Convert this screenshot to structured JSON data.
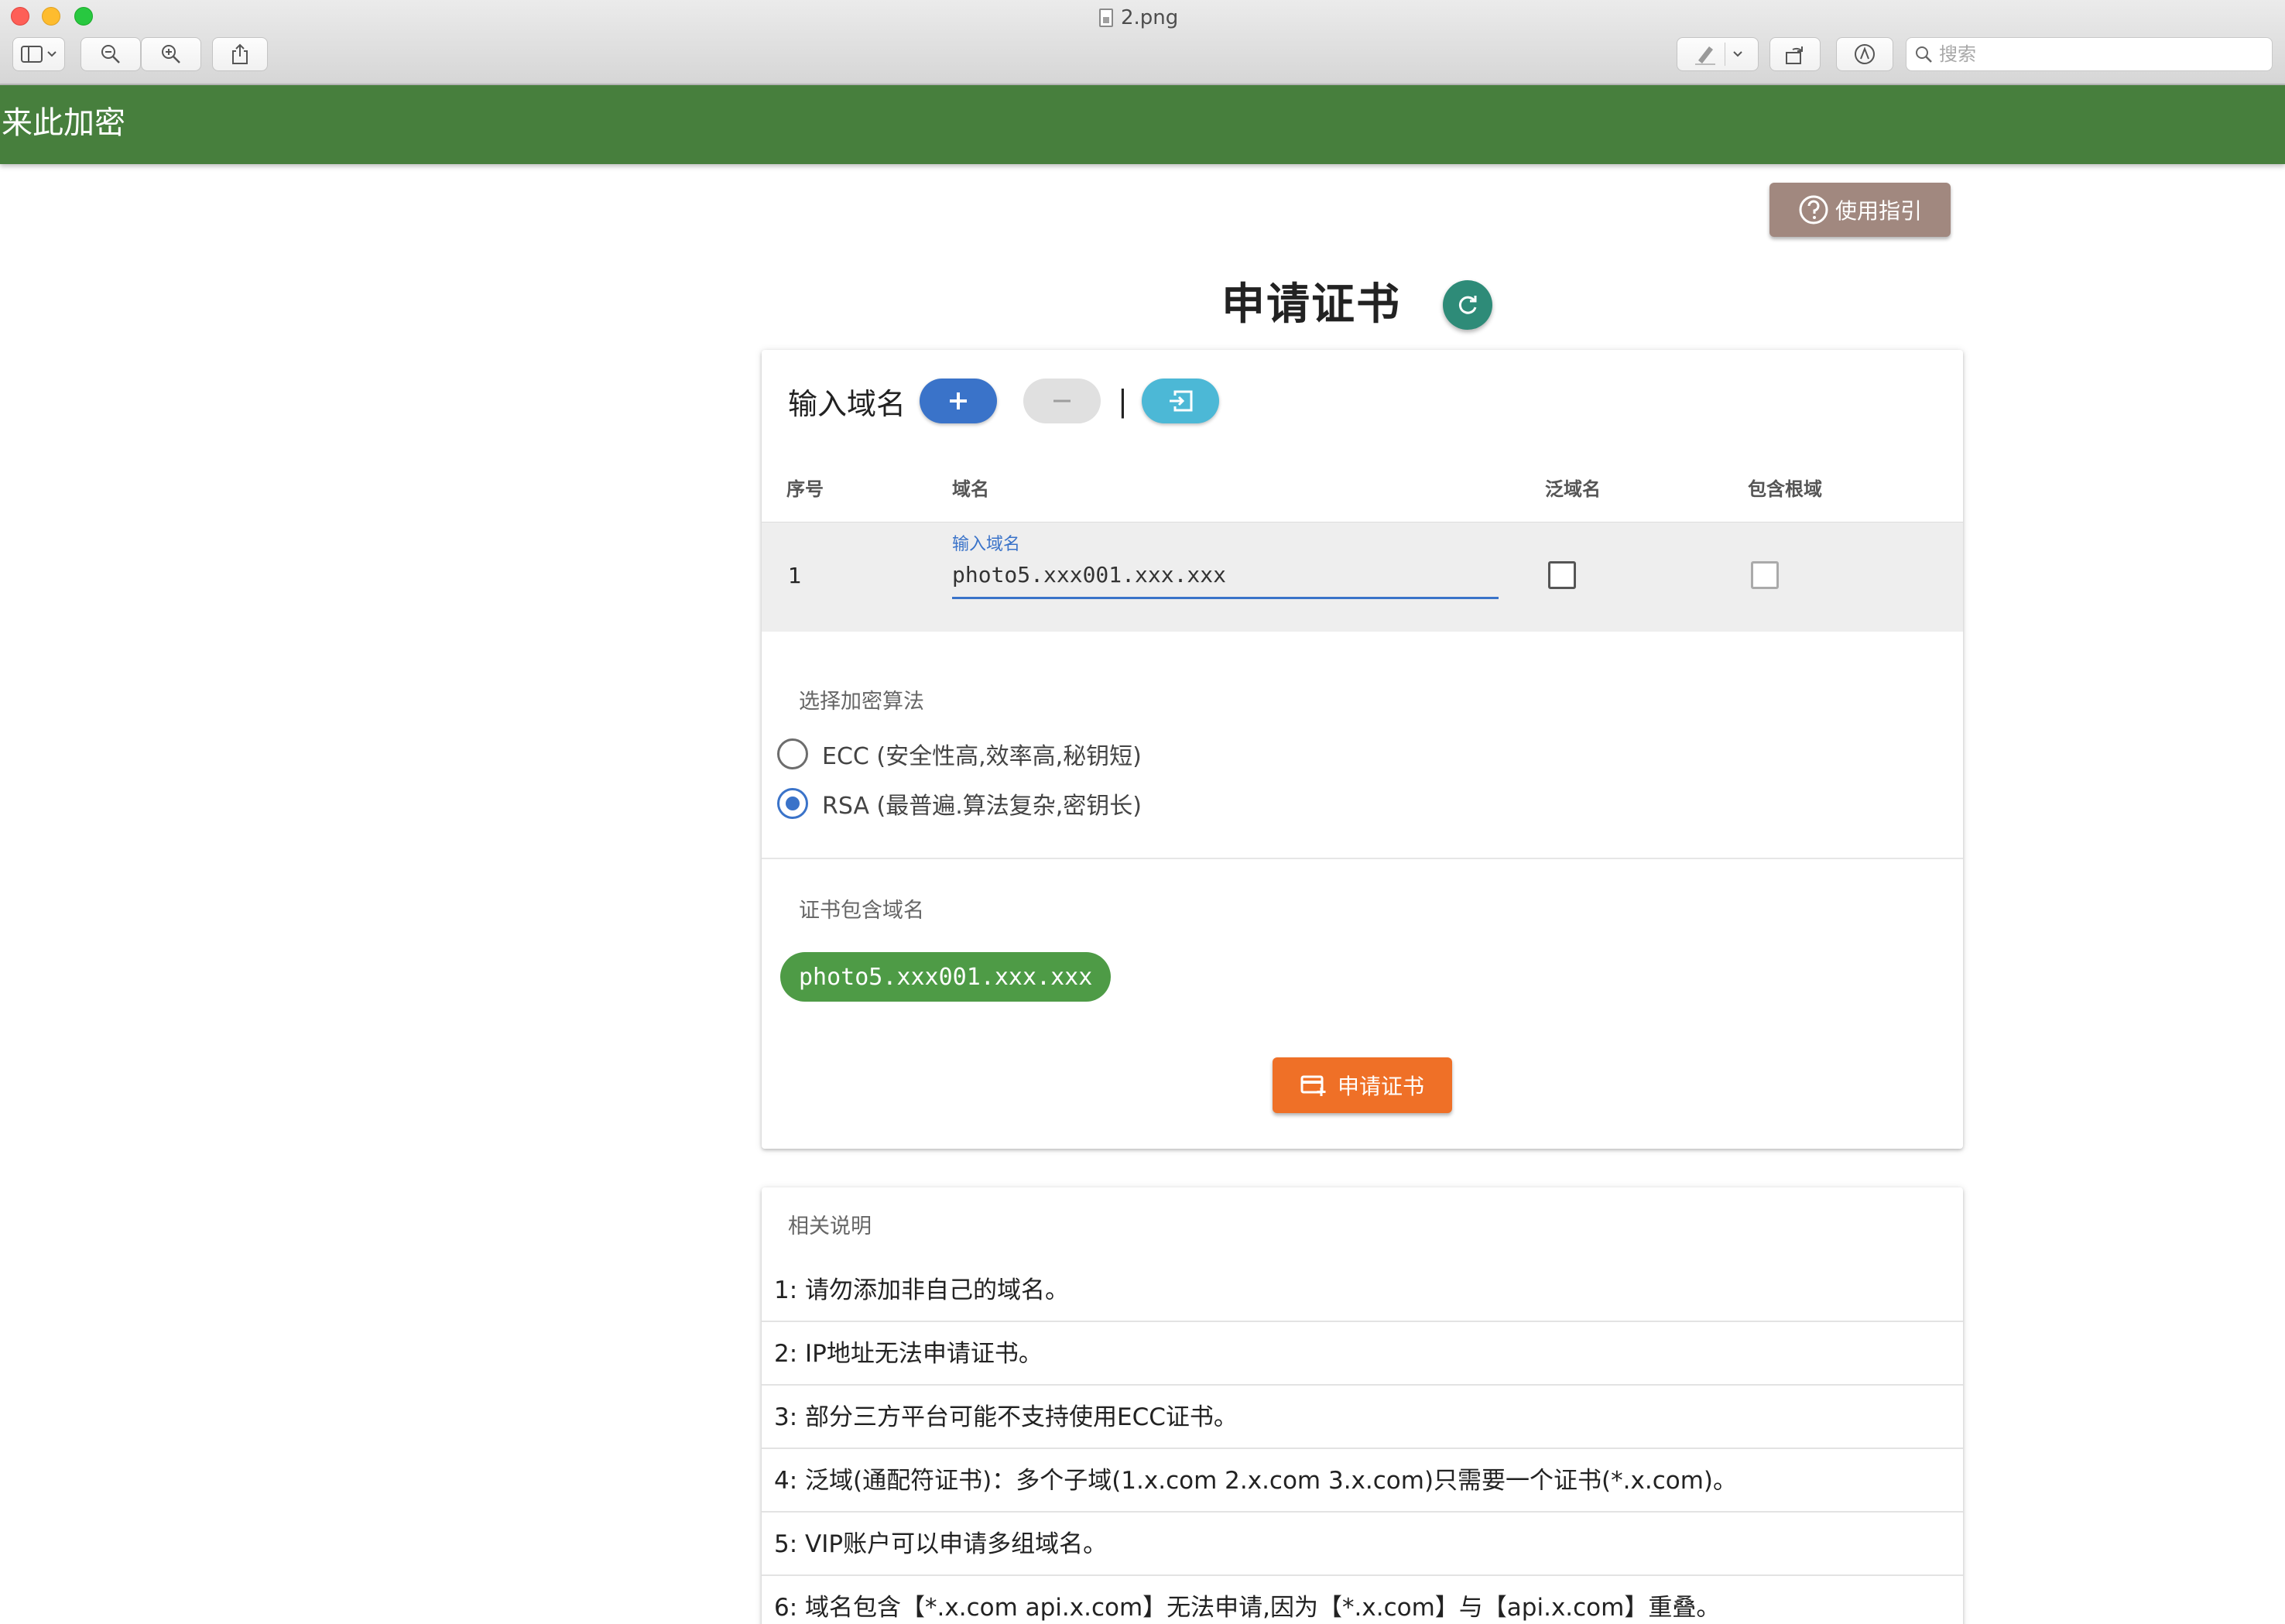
{
  "window": {
    "title": "2.png",
    "search_placeholder": "搜索"
  },
  "app": {
    "title": "来此加密",
    "guide_button": "使用指引",
    "page_title": "申请证书"
  },
  "domain_input": {
    "section_label": "输入域名",
    "columns": [
      "序号",
      "域名",
      "泛域名",
      "包含根域"
    ],
    "rows": [
      {
        "index": "1",
        "field_label": "输入域名",
        "value": "photo5.xxx001.xxx.xxx",
        "wildcard": false,
        "include_root": false
      }
    ]
  },
  "algorithm": {
    "label": "选择加密算法",
    "options": [
      {
        "label": "ECC (安全性高,效率高,秘钥短)",
        "selected": false
      },
      {
        "label": "RSA (最普遍.算法复杂,密钥长)",
        "selected": true
      }
    ]
  },
  "cert_domains": {
    "label": "证书包含域名",
    "chips": [
      "photo5.xxx001.xxx.xxx"
    ]
  },
  "apply_button": "申请证书",
  "notes": {
    "title": "相关说明",
    "items": [
      "1: 请勿添加非自己的域名。",
      "2: IP地址无法申请证书。",
      "3: 部分三方平台可能不支持使用ECC证书。",
      "4: 泛域(通配符证书)：多个子域(1.x.com 2.x.com 3.x.com)只需要一个证书(*.x.com)。",
      "5: VIP账户可以申请多组域名。",
      "6: 域名包含【*.x.com api.x.com】无法申请,因为【*.x.com】与【api.x.com】重叠。"
    ]
  },
  "colors": {
    "header_green": "#477f3d",
    "primary_blue": "#3a73c9",
    "chip_green": "#4e9b46",
    "apply_orange": "#ef7027",
    "guide_brown": "#a1887f",
    "refresh_teal": "#2e8b78"
  }
}
